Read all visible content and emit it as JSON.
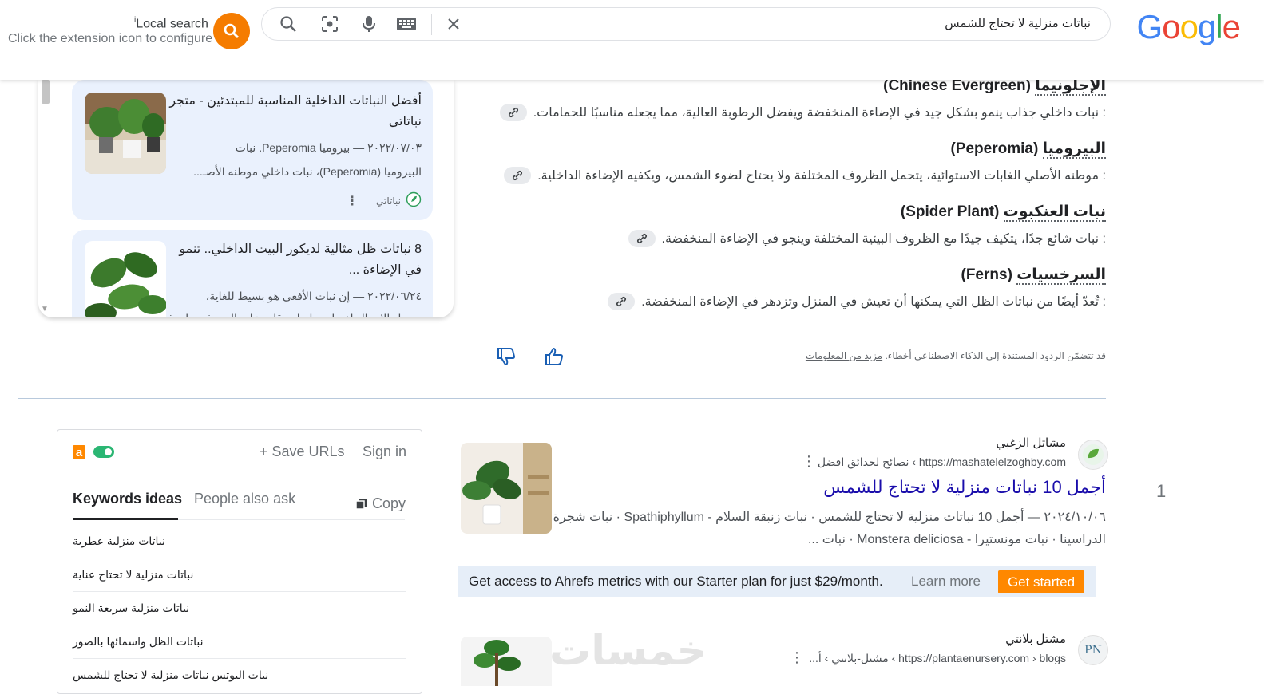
{
  "header": {
    "logo": "Google",
    "query": "نباتات منزلية لا تحتاج للشمس",
    "local_search": {
      "title": "Local search",
      "info_mark": "i",
      "subtitle": "Click the extension icon to configure"
    },
    "icons": [
      "close-icon",
      "keyboard-icon",
      "mic-icon",
      "lens-icon",
      "search-icon"
    ]
  },
  "sources": [
    {
      "title": "أفضل النباتات الداخلية المناسبة للمبتدئين - متجر نباتاتي",
      "snippet1": "٢٠٢٢/٠٧/٠٣ — بيروميا Peperomia. نبات",
      "snippet2": "البيروميا (Peperomia)، نبات داخلي موطنه الأصـ...",
      "source": "نباتاتي"
    },
    {
      "title": "8 نباتات ظل مثالية لديكور البيت الداخلي.. تنمو في الإضاءة ...",
      "snippet1": "٢٠٢٢/٠٦/٢٤ — إن نبات الأفعى هو بسيط للغاية،",
      "snippet2": "يحتمل الإهمال لفترات طويلة وقادر على النمو في ظروف"
    }
  ],
  "ai_overview": [
    {
      "name_ar": "الإجلونيما",
      "name_en": "(Chinese Evergreen)",
      "text": ": نبات داخلي جذاب ينمو بشكل جيد في الإضاءة المنخفضة ويفضل الرطوبة العالية، مما يجعله مناسبًا للحمامات."
    },
    {
      "name_ar": "البيروميا",
      "name_en": "(Peperomia)",
      "text": ": موطنه الأصلي الغابات الاستوائية، يتحمل الظروف المختلفة ولا يحتاج لضوء الشمس، ويكفيه الإضاءة الداخلية."
    },
    {
      "name_ar": "نبات العنكبوت",
      "name_en": "(Spider Plant)",
      "text": ": نبات شائع جدًا، يتكيف جيدًا مع الظروف البيئية المختلفة وينجو في الإضاءة المنخفضة."
    },
    {
      "name_ar": "السرخسيات",
      "name_en": "(Ferns)",
      "text": ": تُعدّ أيضًا من نباتات الظل التي يمكنها أن تعيش في المنزل وتزدهر في الإضاءة المنخفضة."
    }
  ],
  "disclaimer": {
    "text": "قد تتضمّن الردود المستندة إلى الذكاء الاصطناعي أخطاء.",
    "more": "مزيد من المعلومات"
  },
  "keywords_panel": {
    "save_urls": "Save URLs",
    "sign_in": "Sign in",
    "tabs": [
      "Keywords ideas",
      "People also ask"
    ],
    "copy": "Copy",
    "items": [
      "نباتات منزلية عطرية",
      "نباتات منزلية لا تحتاج عناية",
      "نباتات منزلية سريعة النمو",
      "نباتات الظل واسمائها بالصور",
      "نبات البوتس نباتات منزلية لا تحتاج للشمس"
    ]
  },
  "results": [
    {
      "number": "1",
      "site": "مشاتل الزغبي",
      "url": "https://mashatelelzoghby.com › نصائح لحدائق افضل",
      "title": "أجمل 10 نباتات منزلية لا تحتاج للشمس",
      "snippet1": "٢٠٢٤/١٠/٠٦ — أجمل 10 نباتات منزلية لا تحتاج للشمس · نبات زنبقة السلام - Spathiphyllum · نبات شجرة",
      "snippet2": "الدراسينا · نبات مونستيرا - Monstera deliciosa · نبات ..."
    },
    {
      "site": "مشتل بلانتي",
      "url": "https://plantaenursery.com › blogs › مشتل-بلانتي › أ..."
    }
  ],
  "ahrefs_bar": {
    "text": "Get access to Ahrefs metrics with our Starter plan for just $29/month.",
    "learn_more": "Learn more",
    "cta": "Get started"
  },
  "watermark": "خمسات"
}
